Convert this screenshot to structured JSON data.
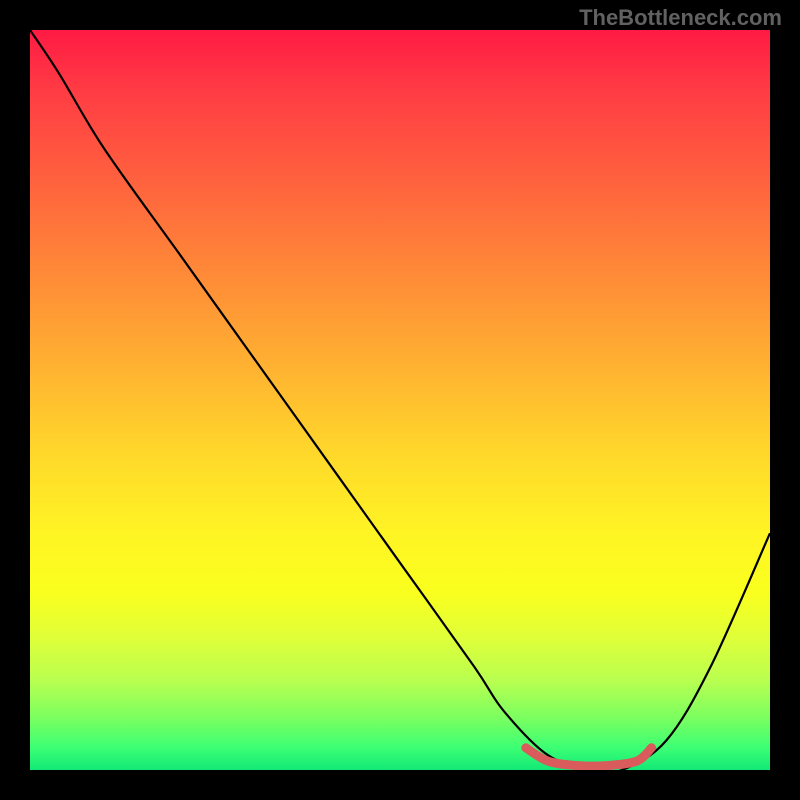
{
  "watermark": "TheBottleneck.com",
  "chart_data": {
    "type": "line",
    "title": "",
    "xlabel": "",
    "ylabel": "",
    "xlim": [
      0,
      100
    ],
    "ylim": [
      0,
      100
    ],
    "series": [
      {
        "name": "bottleneck-curve",
        "x": [
          0,
          4,
          10,
          20,
          30,
          40,
          50,
          60,
          64,
          70,
          76,
          80,
          86,
          92,
          100
        ],
        "values": [
          100,
          94,
          84,
          70,
          56,
          42,
          28,
          14,
          8,
          2,
          0,
          0,
          4,
          14,
          32
        ]
      },
      {
        "name": "optimal-range-marker",
        "x": [
          67,
          70,
          74,
          78,
          82,
          84
        ],
        "values": [
          3,
          1.2,
          0.6,
          0.6,
          1.2,
          3
        ]
      }
    ],
    "gradient_stops": [
      {
        "pos": 0,
        "color": "#ff1a44"
      },
      {
        "pos": 50,
        "color": "#ffba30"
      },
      {
        "pos": 75,
        "color": "#faff1e"
      },
      {
        "pos": 100,
        "color": "#12e876"
      }
    ]
  }
}
